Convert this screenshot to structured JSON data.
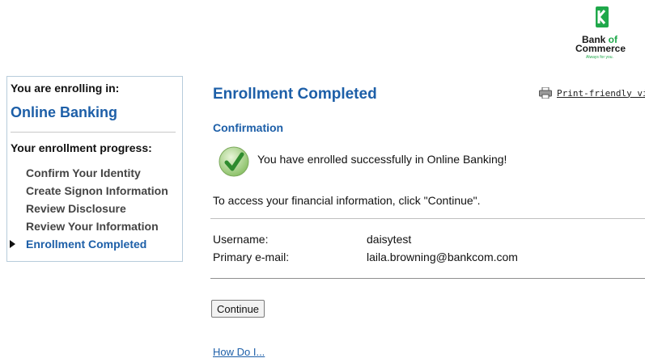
{
  "logo": {
    "line1": "Bank",
    "line1b": "of",
    "line2": "Commerce",
    "tagline": "Always for you."
  },
  "sidebar": {
    "heading": "You are enrolling in:",
    "product": "Online Banking",
    "progress_heading": "Your enrollment progress:",
    "steps": [
      {
        "label": "Confirm Your Identity"
      },
      {
        "label": "Create Signon Information"
      },
      {
        "label": "Review Disclosure"
      },
      {
        "label": "Review Your Information"
      },
      {
        "label": "Enrollment Completed",
        "current": true
      }
    ]
  },
  "main": {
    "title": "Enrollment Completed",
    "print_label": "Print-friendly view",
    "section": "Confirmation",
    "success_msg": "You have enrolled successfully in Online Banking!",
    "access_msg": "To access your financial information, click \"Continue\".",
    "fields": [
      {
        "label": "Username:",
        "value": "daisytest"
      },
      {
        "label": "Primary e-mail:",
        "value": "laila.browning@bankcom.com"
      }
    ],
    "continue_label": "Continue",
    "howdoi_label": "How Do I..."
  },
  "colors": {
    "brand_green": "#1fa84a",
    "link_blue": "#1d5fa8"
  },
  "icons": [
    "bank-logo-icon",
    "printer-icon",
    "success-check-icon",
    "current-step-arrow-icon"
  ]
}
